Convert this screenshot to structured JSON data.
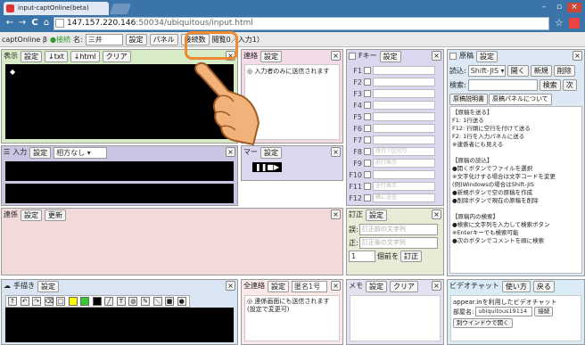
{
  "browser": {
    "tab_title": "input-captOnline(beta)",
    "url_host": "147.157.220.146",
    "url_rest": ":50034/ubiquitous/input.html",
    "minimize": "–",
    "maximize": "▫",
    "close": "×",
    "back": "←",
    "forward": "→",
    "reload": "C",
    "home": "⌂",
    "star": "☆"
  },
  "app_toolbar": {
    "app_name": "captOnline β",
    "status": "●接続",
    "name_label": "名:",
    "name_value": "三井",
    "settings_btn": "設定",
    "panel_btn": "パネル",
    "connected_count": "接続数",
    "room_info": "閲覧0／入力1）"
  },
  "display_panel": {
    "label": "表示",
    "settings": "設定",
    "txt": "↓txt",
    "html": "↓html",
    "clear": "クリア",
    "close": "×"
  },
  "contact_panel": {
    "label": "連絡",
    "settings": "設定",
    "message": "◎ 入力者のみに送信されます",
    "close": "×"
  },
  "fkey_panel": {
    "label": "Fキー",
    "settings": "設定",
    "close": "×",
    "keys": [
      {
        "key": "F1",
        "placeholder": ""
      },
      {
        "key": "F2",
        "placeholder": ""
      },
      {
        "key": "F3",
        "placeholder": ""
      },
      {
        "key": "F4",
        "placeholder": ""
      },
      {
        "key": "F5",
        "placeholder": ""
      },
      {
        "key": "F6",
        "placeholder": ""
      },
      {
        "key": "F7",
        "placeholder": ""
      },
      {
        "key": "F8",
        "placeholder": "改行で区切り"
      },
      {
        "key": "F9",
        "placeholder": "前行表示"
      },
      {
        "key": "F10",
        "placeholder": ""
      },
      {
        "key": "F11",
        "placeholder": "全行表示"
      },
      {
        "key": "F12",
        "placeholder": "隣に送信"
      }
    ]
  },
  "manuscript_panel": {
    "label": "原稿",
    "settings": "設定",
    "close": "×",
    "read_label": "読込:",
    "encoding": "Shift-JIS ▾",
    "open_btn": "開く",
    "new_btn": "新規",
    "delete_btn": "削除",
    "search_label": "検索:",
    "search_btn": "検索",
    "next_btn": "次",
    "tab1": "原稿説明書",
    "tab2": "原稿パネルについて",
    "help_lines": [
      "【原稿を送る】",
      "F1: 1行送る",
      "F12: 行頭に空行を付けて送る",
      "F2: 1行を入力パネルに送る",
      "※連係者にも見える",
      "",
      "【原稿の読込】",
      "●開くボタンでファイルを選択",
      "※文字化けする場合は文字コードを変更",
      "(例)Windowsの場合はShift-JIS",
      "●新規ボタンで空の原稿を作成",
      "●削除ボタンで現在の原稿を削除",
      "",
      "【原稿内の検索】",
      "●検索に文字列を入力して検索ボタン",
      "※Enterキーでも検索可能",
      "●次のボタンでコメントを順に検索"
    ]
  },
  "input_panel": {
    "label": "入力",
    "settings": "設定",
    "mode": "相方なし ▾",
    "close": "×"
  },
  "timer_panel": {
    "label": "マー",
    "settings": "設定",
    "close": "×",
    "controls": "❚❚■▶"
  },
  "liaison_panel": {
    "label": "連係",
    "settings": "設定",
    "update": "更新",
    "close": "×"
  },
  "correction_panel": {
    "label": "訂正",
    "settings": "設定",
    "close": "×",
    "wrong_label": "誤:",
    "wrong_placeholder": "訂正前の文字列",
    "right_label": "正:",
    "right_placeholder": "訂正後の文字列",
    "count_value": "1",
    "count_label": "個前を",
    "correct_btn": "訂正"
  },
  "draw_panel": {
    "label": "手描き",
    "settings": "設定",
    "close": "×",
    "colors": [
      "#ffff00",
      "#33cc33",
      "#000000"
    ]
  },
  "all_contact_panel": {
    "label": "全連絡",
    "settings": "設定",
    "anon": "匿名1号",
    "message": "◎ 連係画面にも送信されます(設定で変更可)",
    "close": "×"
  },
  "memo_panel": {
    "label": "メモ",
    "settings": "設定",
    "clear": "クリア",
    "close": "×"
  },
  "video_panel": {
    "label": "ビデオチャット",
    "usage": "使い方",
    "back": "戻る",
    "line1": "appear.inを利用したビデオチャット",
    "room_label": "部屋名:",
    "room_value": "ubiquitous19114",
    "connect_btn": "接続",
    "open_window_btn": "別ウインドウで開く"
  },
  "colors": {
    "display_bg": "#d7ebc7",
    "contact_bg": "#f3dbe8",
    "fkey_bg": "#dcd6ee",
    "manuscript_bg": "#dce9f4",
    "input_bg": "#cbc5e3",
    "liaison_bg": "#f3dada",
    "correction_bg": "#e8ecd7",
    "draw_bg": "#d9e5f3",
    "memo_bg": "#e5e0f2",
    "video_bg": "#d9ecf6",
    "accent_orange": "#f08a30"
  }
}
